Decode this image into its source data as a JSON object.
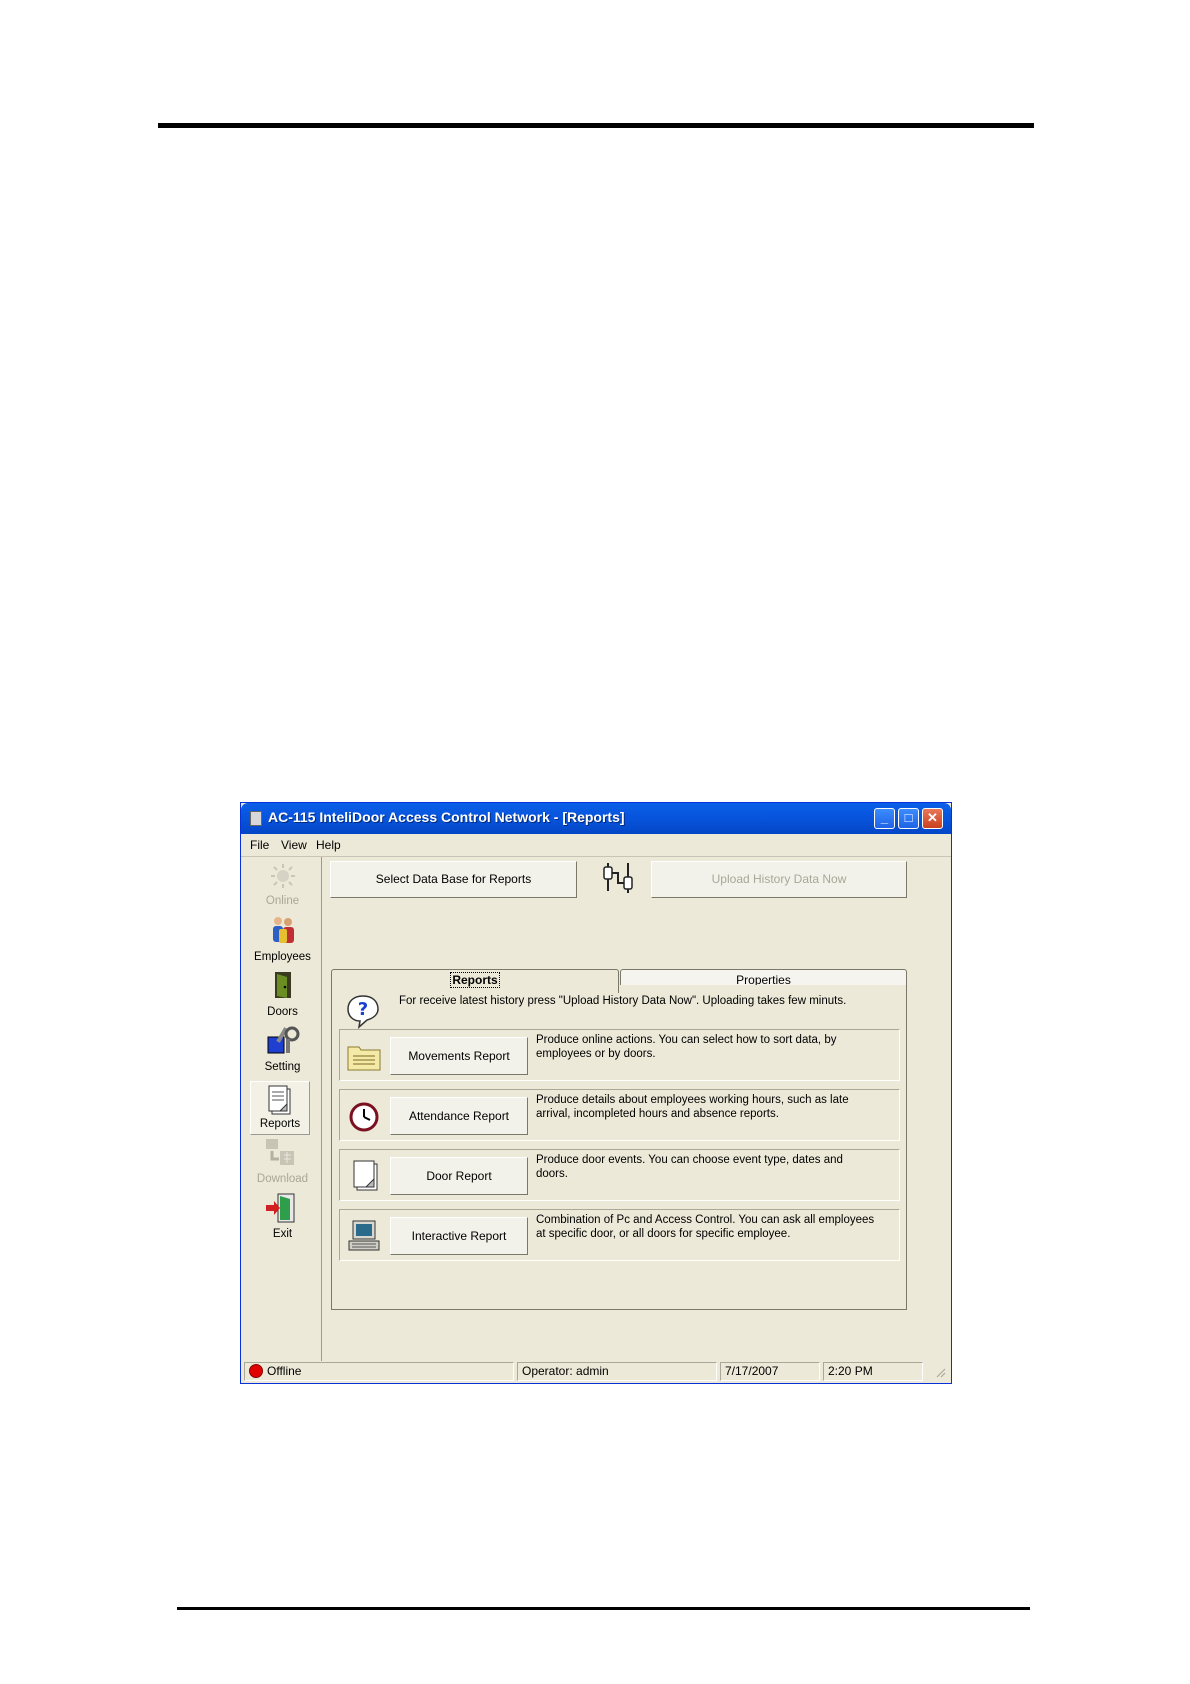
{
  "window": {
    "title": "AC-115 InteliDoor Access Control Network - [Reports]",
    "controls": {
      "minimize": "_",
      "maximize": "□",
      "close": "✕"
    }
  },
  "menu": [
    "File",
    "View",
    "Help"
  ],
  "sidebar": {
    "items": [
      {
        "label": "Online",
        "icon": "sun-icon",
        "enabled": false
      },
      {
        "label": "Employees",
        "icon": "people-icon",
        "enabled": true
      },
      {
        "label": "Doors",
        "icon": "door-icon",
        "enabled": true
      },
      {
        "label": "Setting",
        "icon": "tools-icon",
        "enabled": true
      },
      {
        "label": "Reports",
        "icon": "document-icon",
        "enabled": true,
        "selected": true
      },
      {
        "label": "Download",
        "icon": "download-icon",
        "enabled": false
      },
      {
        "label": "Exit",
        "icon": "exit-icon",
        "enabled": true
      }
    ]
  },
  "toolbar": {
    "select_db_label": "Select Data Base for Reports",
    "upload_label": "Upload History Data Now",
    "upload_enabled": false
  },
  "tabs": {
    "reports": "Reports",
    "properties": "Properties",
    "active": "reports"
  },
  "info": {
    "text": "For receive latest history press  \"Upload History Data Now\". Uploading  takes few minuts."
  },
  "reports": [
    {
      "button": "Movements Report",
      "icon": "folder-list-icon",
      "description": "Produce online actions.  You can select how to sort data, by employees or by doors."
    },
    {
      "button": "Attendance Report",
      "icon": "clock-icon",
      "description": "Produce details about employees working hours, such as late arrival, incompleted hours and absence reports."
    },
    {
      "button": "Door Report",
      "icon": "document-icon",
      "description": "Produce door events.  You can choose event type, dates and doors."
    },
    {
      "button": "Interactive Report",
      "icon": "computer-icon",
      "description": "Combination of Pc and Access Control. You can ask all employees at specific door, or all doors for specific employee."
    }
  ],
  "status": {
    "connection": "Offline",
    "operator": "Operator: admin",
    "date": "7/17/2007",
    "time": "2:20 PM"
  },
  "colors": {
    "titlebar": "#0855dd",
    "window_bg": "#ece9d8",
    "offline_dot": "#e00000"
  }
}
